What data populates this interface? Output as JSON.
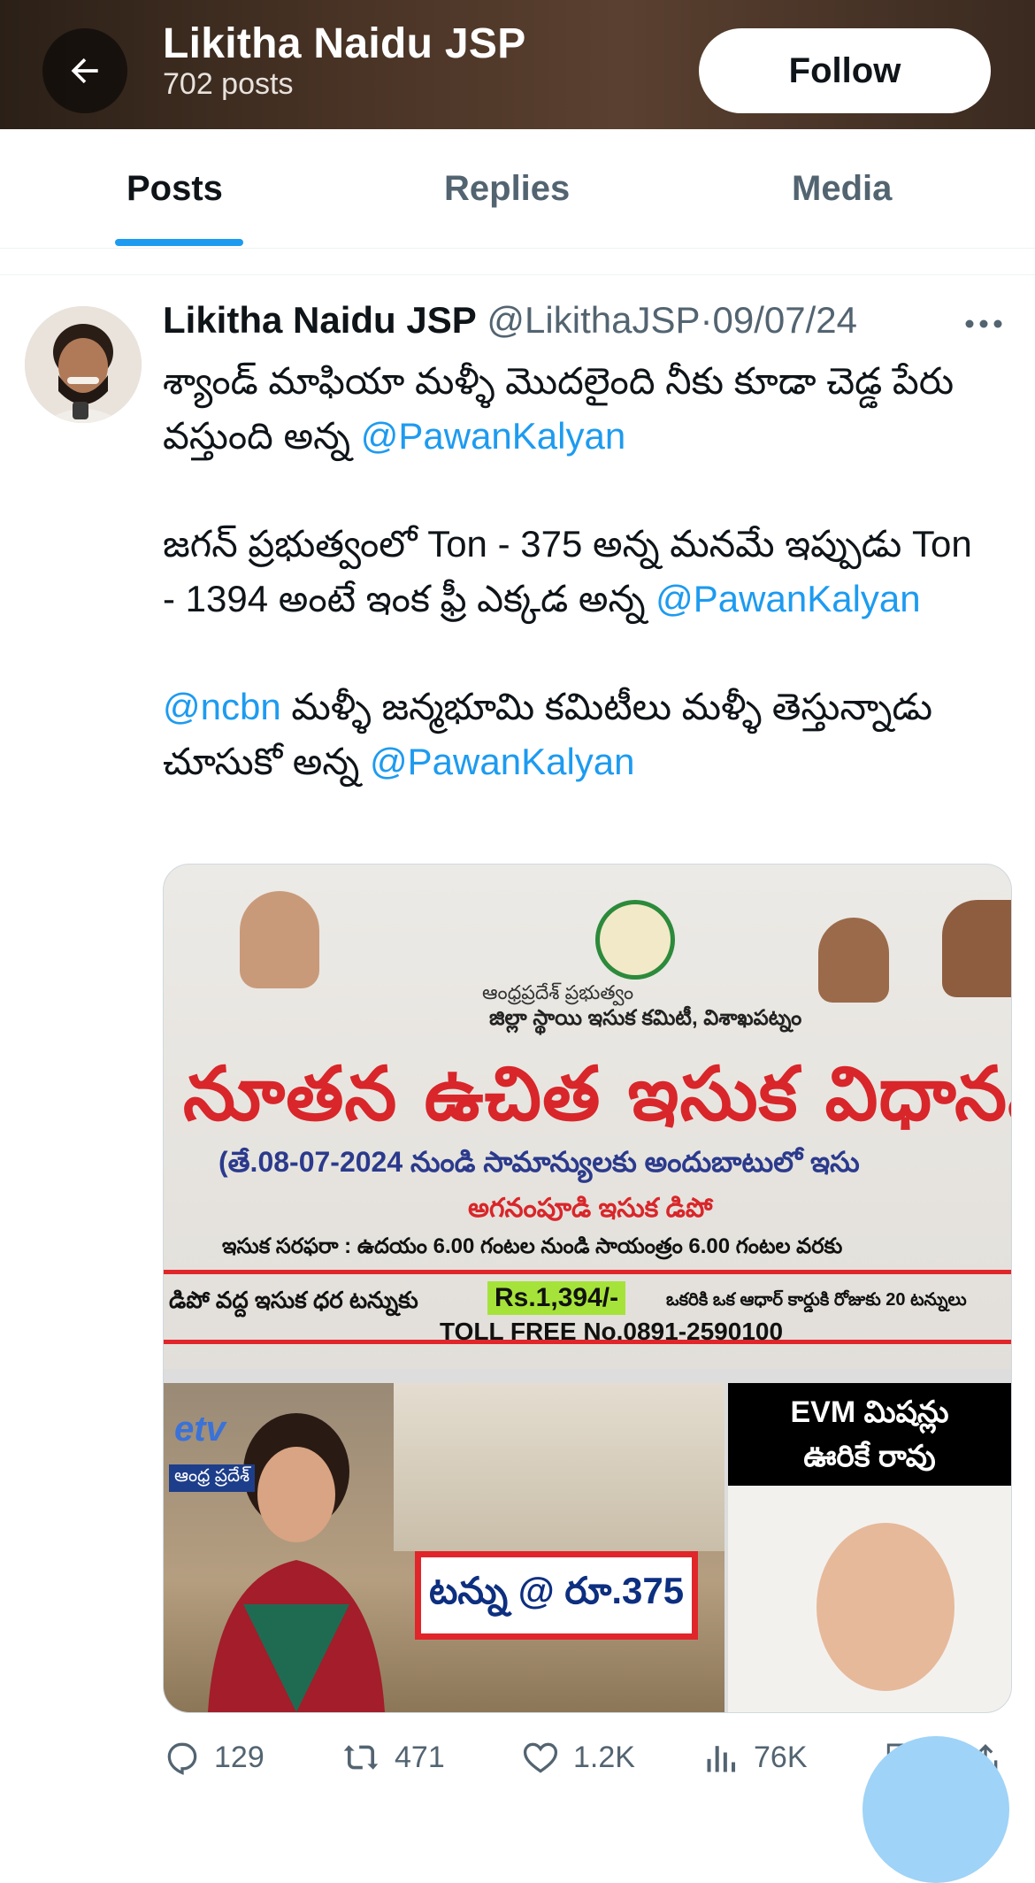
{
  "header": {
    "title": "Likitha Naidu JSP",
    "post_count": "702 posts",
    "follow_label": "Follow"
  },
  "tabs": [
    {
      "label": "Posts",
      "active": true
    },
    {
      "label": "Replies",
      "active": false
    },
    {
      "label": "Media",
      "active": false
    }
  ],
  "post": {
    "author": "Likitha Naidu JSP",
    "handle": "@LikithaJSP",
    "separator": "·",
    "date": "09/07/24",
    "paragraphs": [
      {
        "text": "శ్యాండ్ మాఫియా మళ్ళీ మొదలైంది నీకు కూడా చెడ్డ పేరు వస్తుంది అన్న ",
        "mention": "@PawanKalyan"
      },
      {
        "text": "జగన్ ప్రభుత్వంలో Ton - 375 అన్న మనమే ఇప్పుడు Ton - 1394 అంటే ఇంక ఫ్రీ ఎక్కడ అన్న ",
        "mention": "@PawanKalyan"
      },
      {
        "lead_mention": "@ncbn",
        "text": " మళ్ళీ జన్మభూమి కమిటీలు మళ్ళీ తెస్తున్నాడు చూసుకో అన్న ",
        "mention": "@PawanKalyan"
      }
    ],
    "media": {
      "org_line": "ఆంధ్రప్రదేశ్ ప్రభుత్వం",
      "committee": "జిల్లా స్థాయి ఇసుక కమిటీ, విశాఖపట్నం",
      "title": "నూతన ఉచిత ఇసుక విధానవ",
      "date_line": "(తే.08-07-2024 నుండి సామాన్యులకు అందుబాటులో ఇసు",
      "depot": "అగనంపూడి ఇసుక డిపో",
      "timing": "ఇసుక సరఫరా : ఉదయం 6.00 గంటల నుండి సాయంత్రం 6.00 గంటల వరకు",
      "price_left": "డిపో వద్ద ఇసుక ధర టన్నుకు",
      "price": "Rs.1,394/-",
      "price_right": "ఒకరికి ఒక ఆధార్ కార్డుకి రోజుకు 20 టన్నులు",
      "toll_free": "TOLL FREE No.0891-2590100",
      "etv_logo": "etv",
      "etv_channel": "ఆంధ్ర ప్రదేశ్",
      "tonnu": "టన్ను @ రూ.375",
      "evm_line1": "EVM మిషన్లు",
      "evm_line2": "ఊరికే రావు"
    },
    "actions": {
      "replies": "129",
      "reposts": "471",
      "likes": "1.2K",
      "views": "76K"
    }
  },
  "colors": {
    "accent": "#1d9bf0",
    "text": "#0f1419",
    "muted": "#536471",
    "banner_red": "#d8262a"
  }
}
